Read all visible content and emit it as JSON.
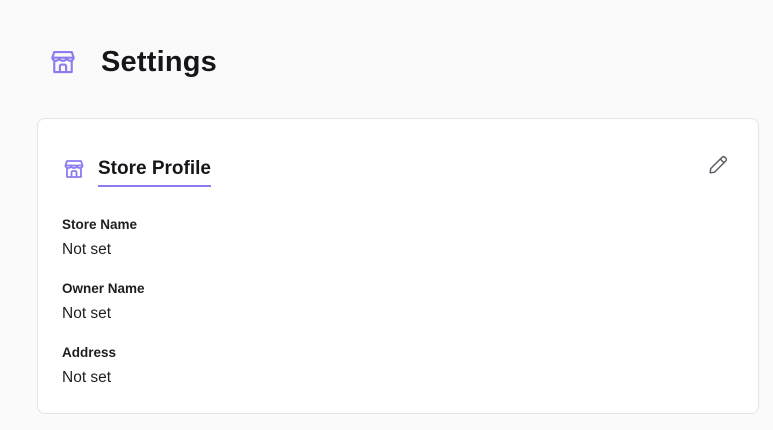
{
  "header": {
    "title": "Settings",
    "icon": "store-icon",
    "accent_color": "#8b7cf0"
  },
  "store_profile": {
    "title": "Store Profile",
    "icon": "store-icon",
    "edit_icon": "pencil-icon",
    "fields": [
      {
        "label": "Store Name",
        "value": "Not set"
      },
      {
        "label": "Owner Name",
        "value": "Not set"
      },
      {
        "label": "Address",
        "value": "Not set"
      }
    ]
  }
}
